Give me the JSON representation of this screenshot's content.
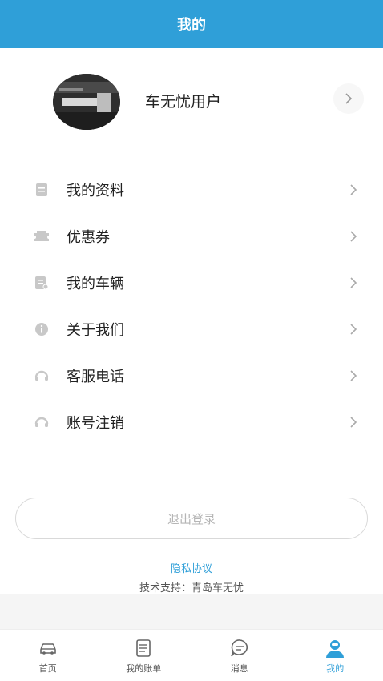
{
  "header": {
    "title": "我的"
  },
  "profile": {
    "username": "车无忧用户"
  },
  "menu": {
    "items": [
      {
        "label": "我的资料",
        "icon": "profile-doc-icon"
      },
      {
        "label": "优惠券",
        "icon": "coupon-icon"
      },
      {
        "label": "我的车辆",
        "icon": "vehicle-doc-icon"
      },
      {
        "label": "关于我们",
        "icon": "info-icon"
      },
      {
        "label": "客服电话",
        "icon": "headset-icon"
      },
      {
        "label": "账号注销",
        "icon": "headset-icon"
      }
    ]
  },
  "logout": {
    "label": "退出登录"
  },
  "footer": {
    "privacy": "隐私协议",
    "support": "技术支持：青岛车无忧"
  },
  "tabbar": {
    "tabs": [
      {
        "label": "首页",
        "icon": "car-icon"
      },
      {
        "label": "我的账单",
        "icon": "bill-icon"
      },
      {
        "label": "消息",
        "icon": "message-icon"
      },
      {
        "label": "我的",
        "icon": "user-icon",
        "active": true
      }
    ]
  },
  "colors": {
    "accent": "#2f9fd8",
    "icon_gray": "#c8c8c8"
  }
}
